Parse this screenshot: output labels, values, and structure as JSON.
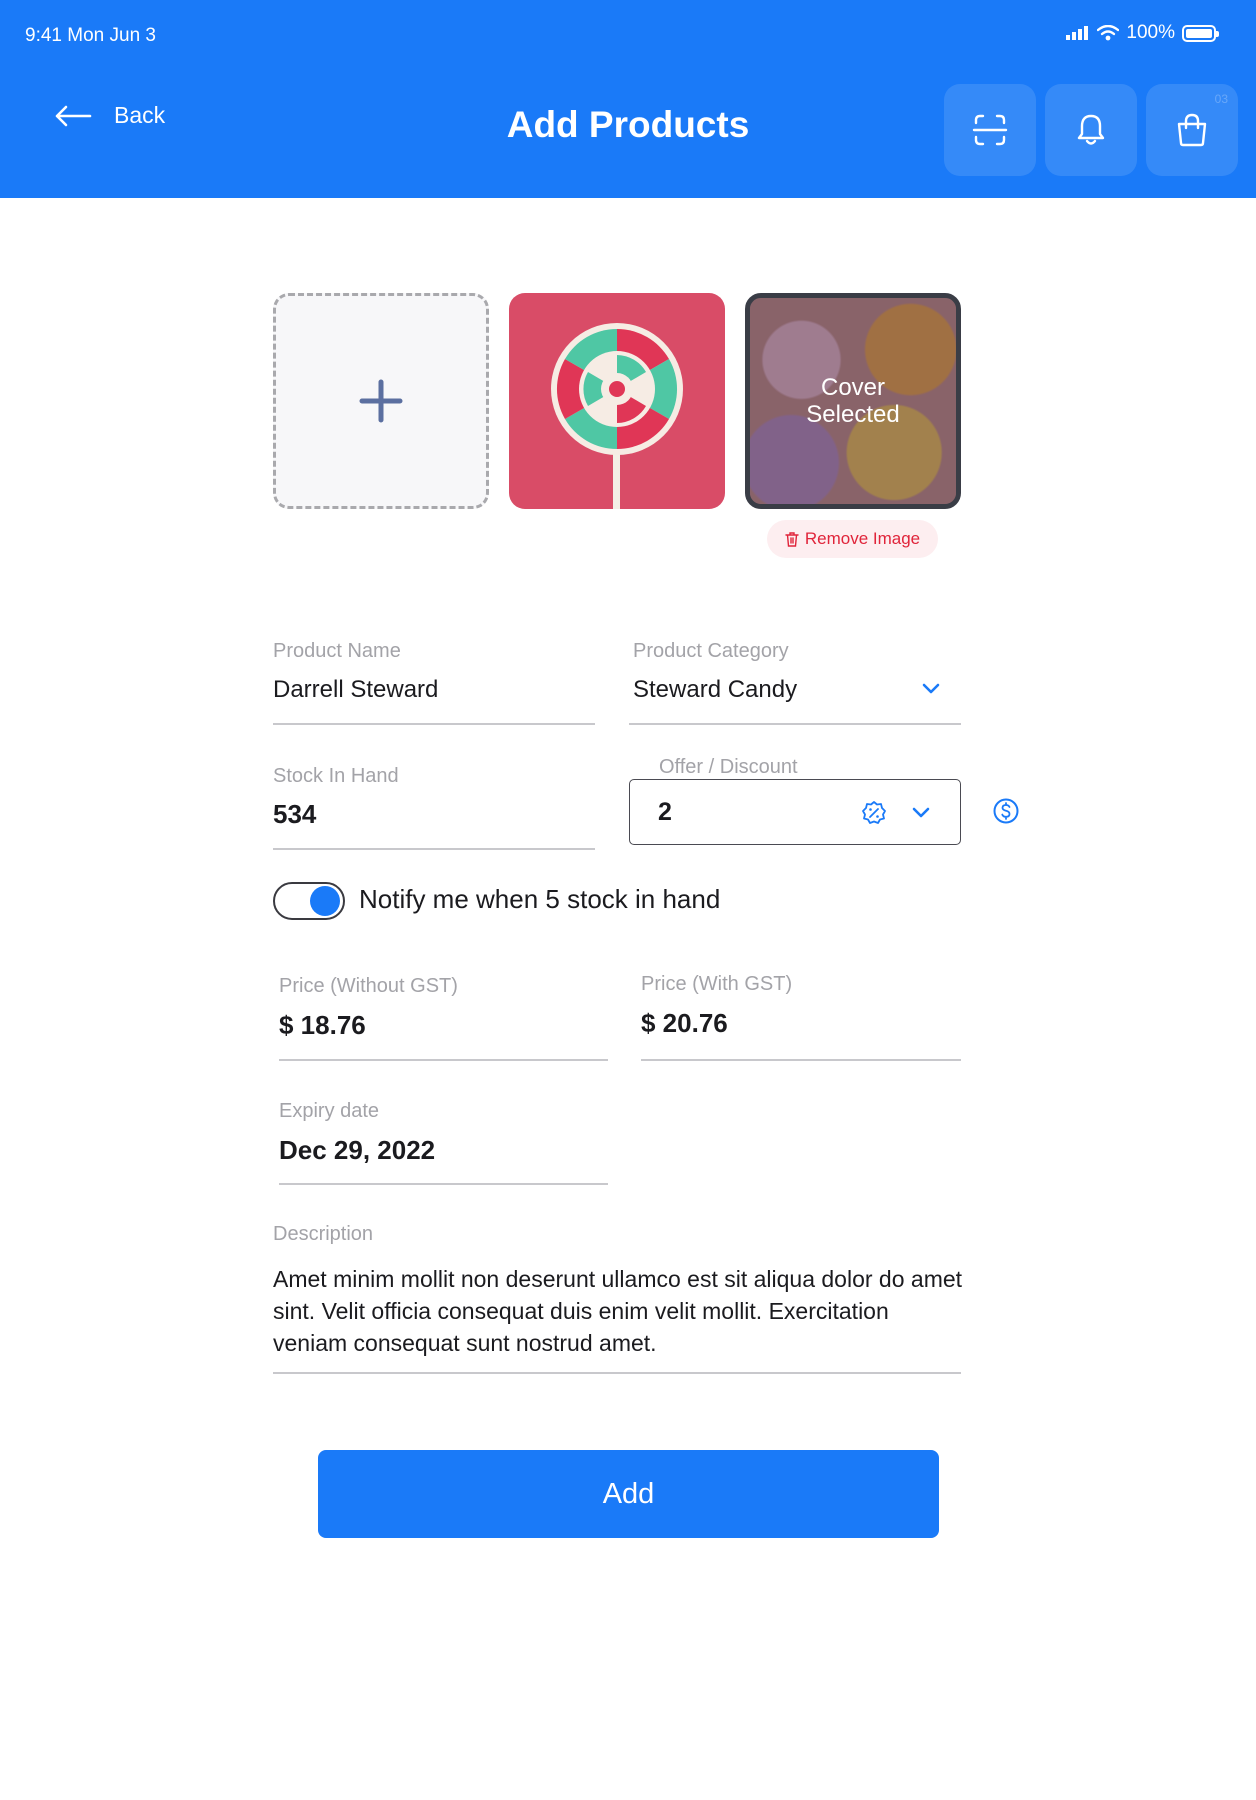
{
  "status_bar": {
    "time": "9:41 Mon Jun 3",
    "battery": "100%"
  },
  "header": {
    "back_label": "Back",
    "title": "Add Products",
    "cart_badge": "03",
    "icons": [
      "scan-icon",
      "bell-icon",
      "shopping-bag-icon"
    ]
  },
  "images": {
    "cover_overlay_line1": "Cover",
    "cover_overlay_line2": "Selected",
    "remove_label": "Remove Image"
  },
  "form": {
    "product_name": {
      "label": "Product Name",
      "value": "Darrell Steward"
    },
    "product_category": {
      "label": "Product Category",
      "value": "Steward Candy"
    },
    "stock_in_hand": {
      "label": "Stock In Hand",
      "value": "534"
    },
    "offer_discount": {
      "label": "Offer / Discount",
      "value": "2"
    },
    "notify": {
      "label": "Notify me when 5 stock in hand",
      "enabled": true
    },
    "price_without_gst": {
      "label": "Price (Without GST)",
      "value": "$ 18.76"
    },
    "price_with_gst": {
      "label": "Price (With GST)",
      "value": "$ 20.76"
    },
    "expiry_date": {
      "label": "Expiry date",
      "value": "Dec 29, 2022"
    },
    "description": {
      "label": "Description",
      "value": "Amet minim mollit non deserunt ullamco est sit aliqua dolor do amet sint. Velit officia consequat duis enim velit mollit. Exercitation veniam consequat sunt nostrud amet."
    }
  },
  "actions": {
    "add_label": "Add"
  },
  "colors": {
    "primary": "#1a7af8",
    "danger": "#e0243a",
    "muted": "#a3a3a8"
  }
}
